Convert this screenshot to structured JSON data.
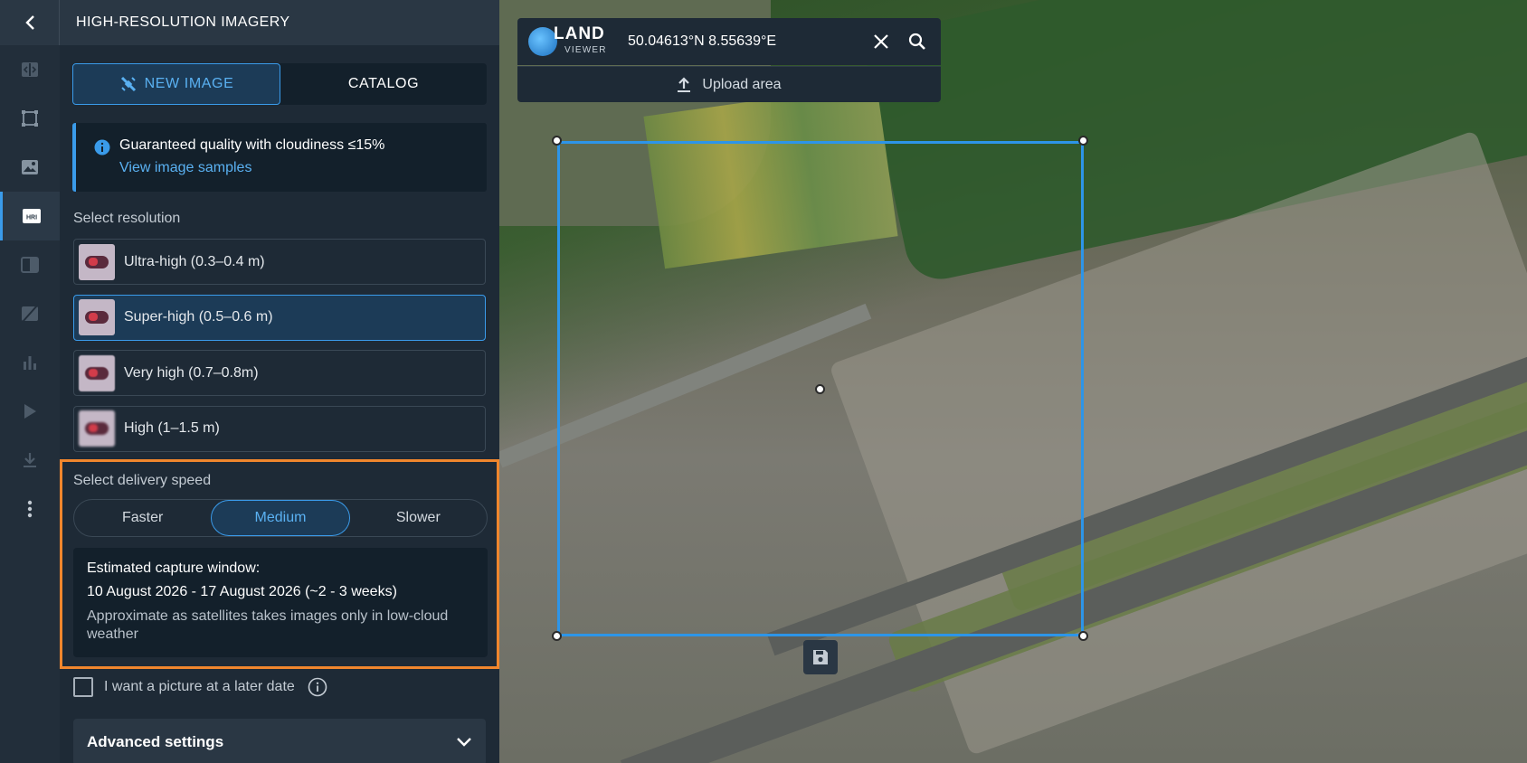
{
  "header": {
    "title": "HIGH-RESOLUTION IMAGERY"
  },
  "rail": {
    "items": [
      {
        "icon": "compare-icon",
        "active": false
      },
      {
        "icon": "draw-area-icon",
        "active": false
      },
      {
        "icon": "image-icon",
        "active": false
      },
      {
        "icon": "hri-icon",
        "label": "HRI",
        "active": true
      },
      {
        "icon": "split-view-icon",
        "active": false
      },
      {
        "icon": "no-image-icon",
        "active": false
      },
      {
        "icon": "analytics-icon",
        "active": false
      },
      {
        "icon": "play-icon",
        "active": false
      },
      {
        "icon": "download-icon",
        "active": false
      },
      {
        "icon": "more-icon",
        "active": false
      }
    ]
  },
  "tabs": {
    "new_image": "NEW IMAGE",
    "catalog": "CATALOG",
    "active": "new_image"
  },
  "info": {
    "text": "Guaranteed quality with cloudiness ≤15%",
    "link": "View image samples"
  },
  "resolution": {
    "label": "Select resolution",
    "options": [
      {
        "label": "Ultra-high (0.3–0.4 m)",
        "selected": false
      },
      {
        "label": "Super-high (0.5–0.6 m)",
        "selected": true
      },
      {
        "label": "Very high (0.7–0.8m)",
        "selected": false
      },
      {
        "label": "High (1–1.5 m)",
        "selected": false
      }
    ]
  },
  "delivery": {
    "label": "Select delivery speed",
    "options": [
      "Faster",
      "Medium",
      "Slower"
    ],
    "selected": "Medium",
    "capture_title": "Estimated capture window:",
    "capture_dates": "10 August 2026 - 17 August 2026 (~2 - 3 weeks)",
    "capture_note": "Approximate as satellites takes images only in low-cloud weather"
  },
  "later_date": {
    "label": "I want a picture at a later date",
    "checked": false
  },
  "advanced": {
    "label": "Advanced settings"
  },
  "search": {
    "logo_main": "LAND",
    "logo_sub": "VIEWER",
    "value": "50.04613°N 8.55639°E",
    "upload_label": "Upload area"
  },
  "colors": {
    "accent": "#3a9bea",
    "highlight_border": "#f0862d",
    "panel_bg": "#1e2a36",
    "aoi_border": "#2d95e8"
  }
}
